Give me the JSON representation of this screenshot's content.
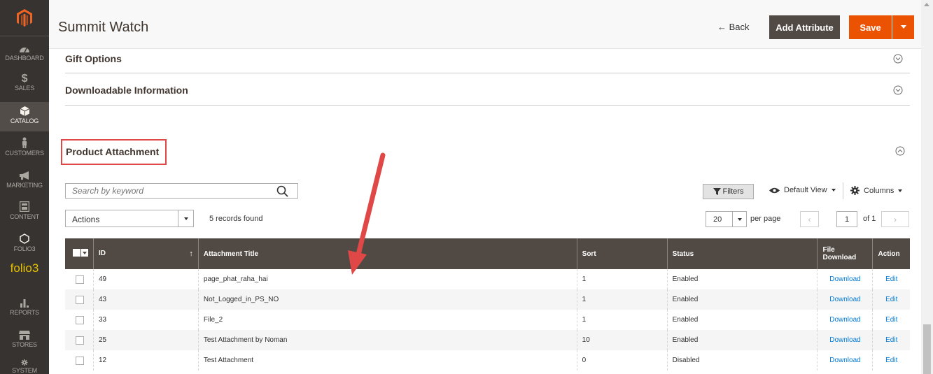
{
  "header": {
    "title": "Summit Watch",
    "back_label": "← Back",
    "add_attribute_label": "Add Attribute",
    "save_label": "Save"
  },
  "sidebar": {
    "items": [
      {
        "label": "DASHBOARD",
        "icon": "dashboard-icon"
      },
      {
        "label": "SALES",
        "icon": "dollar-icon"
      },
      {
        "label": "CATALOG",
        "icon": "cube-icon"
      },
      {
        "label": "CUSTOMERS",
        "icon": "person-icon"
      },
      {
        "label": "MARKETING",
        "icon": "megaphone-icon"
      },
      {
        "label": "CONTENT",
        "icon": "content-icon"
      },
      {
        "label": "FOLIO3",
        "icon": "hexagon-icon"
      },
      {
        "label": "REPORTS",
        "icon": "bar-chart-icon"
      },
      {
        "label": "STORES",
        "icon": "store-icon"
      },
      {
        "label": "SYSTEM",
        "icon": "gear-icon"
      }
    ],
    "brand": "folio3"
  },
  "sections": {
    "gift_options": "Gift Options",
    "downloadable_information": "Downloadable Information",
    "product_attachment": "Product Attachment"
  },
  "grid": {
    "search_placeholder": "Search by keyword",
    "filters_label": "Filters",
    "default_view_label": "Default View",
    "columns_label": "Columns",
    "actions_label": "Actions",
    "records_found": "5 records found",
    "per_page_value": "20",
    "per_page_label": "per page",
    "current_page": "1",
    "of_pages": "of 1",
    "columns": [
      {
        "label": "ID"
      },
      {
        "label": "Attachment Title"
      },
      {
        "label": "Sort"
      },
      {
        "label": "Status"
      },
      {
        "label": "File Download"
      },
      {
        "label": "Action"
      }
    ],
    "rows": [
      {
        "id": "49",
        "title": "page_phat_raha_hai",
        "sort": "1",
        "status": "Enabled",
        "download": "Download",
        "action": "Edit"
      },
      {
        "id": "43",
        "title": "Not_Logged_in_PS_NO",
        "sort": "1",
        "status": "Enabled",
        "download": "Download",
        "action": "Edit"
      },
      {
        "id": "33",
        "title": "File_2",
        "sort": "1",
        "status": "Enabled",
        "download": "Download",
        "action": "Edit"
      },
      {
        "id": "25",
        "title": "Test Attachment by Noman",
        "sort": "10",
        "status": "Enabled",
        "download": "Download",
        "action": "Edit"
      },
      {
        "id": "12",
        "title": "Test Attachment",
        "sort": "0",
        "status": "Disabled",
        "download": "Download",
        "action": "Edit"
      }
    ]
  },
  "colors": {
    "sidebar_bg": "#373330",
    "header_dark": "#514943",
    "save_orange": "#eb5202",
    "link_blue": "#007bdb",
    "annotation_red": "#e04848"
  }
}
